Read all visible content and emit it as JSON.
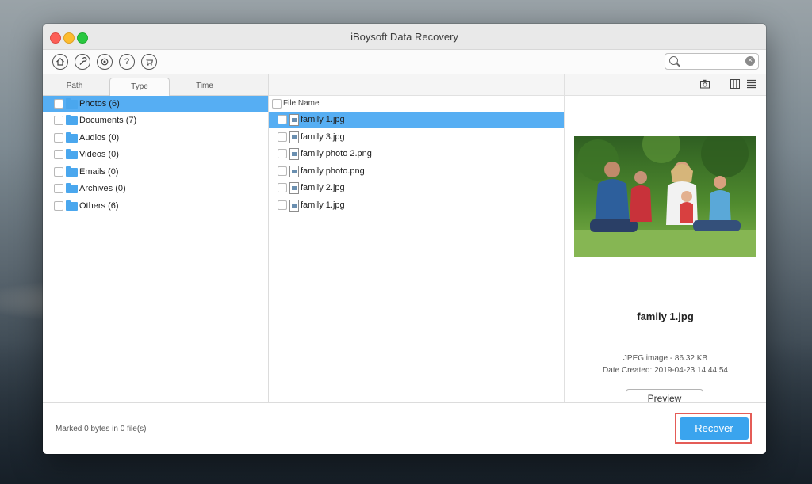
{
  "window": {
    "title": "iBoysoft Data Recovery"
  },
  "toolbar": {
    "icons": [
      "home-icon",
      "wrench-icon",
      "gear-icon",
      "help-icon",
      "cart-icon"
    ],
    "help_glyph": "?",
    "search": {
      "value": "",
      "placeholder": ""
    }
  },
  "left": {
    "tabs": [
      {
        "label": "Path"
      },
      {
        "label": "Type"
      },
      {
        "label": "Time"
      }
    ],
    "active_tab": "Type",
    "types": [
      {
        "label": "Photos (6)",
        "selected": true
      },
      {
        "label": "Documents (7)",
        "selected": false
      },
      {
        "label": "Audios (0)",
        "selected": false
      },
      {
        "label": "Videos (0)",
        "selected": false
      },
      {
        "label": "Emails (0)",
        "selected": false
      },
      {
        "label": "Archives (0)",
        "selected": false
      },
      {
        "label": "Others (6)",
        "selected": false
      }
    ]
  },
  "middle": {
    "header": "File Name",
    "files": [
      {
        "name": "family 1.jpg",
        "selected": true
      },
      {
        "name": "family 3.jpg",
        "selected": false
      },
      {
        "name": "family photo 2.png",
        "selected": false
      },
      {
        "name": "family photo.png",
        "selected": false
      },
      {
        "name": "family 2.jpg",
        "selected": false
      },
      {
        "name": "family 1.jpg",
        "selected": false
      }
    ]
  },
  "preview": {
    "name": "family 1.jpg",
    "type_size": "JPEG image - 86.32 KB",
    "date_created": "Date Created: 2019-04-23 14:44:54",
    "button": "Preview"
  },
  "footer": {
    "status": "Marked 0 bytes in 0 file(s)",
    "recover": "Recover"
  },
  "colors": {
    "selection": "#56aef3",
    "recover_button": "#3aa4ee",
    "highlight_border": "#e45c57"
  }
}
